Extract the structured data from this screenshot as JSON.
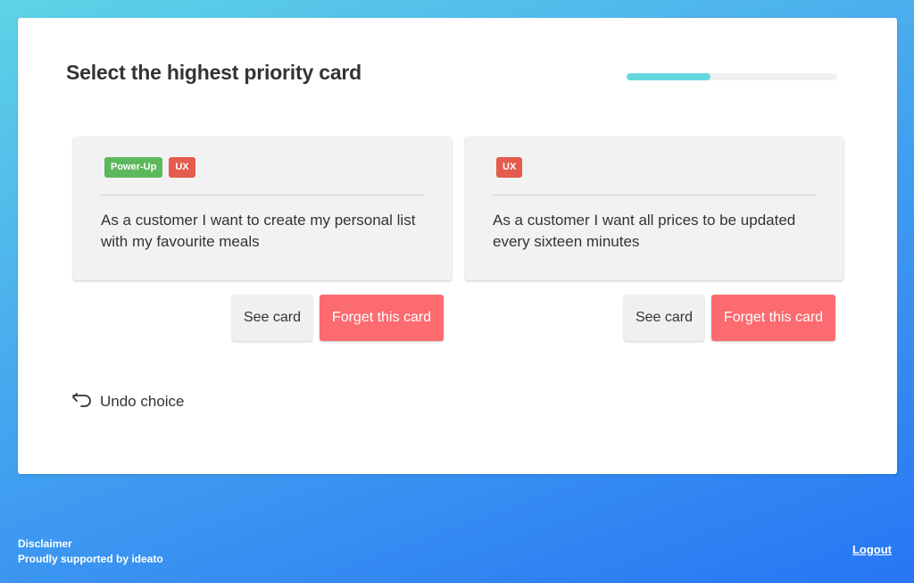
{
  "header": {
    "title": "Select the highest priority card",
    "progress_fraction": 0.4
  },
  "cards": [
    {
      "tags": [
        "Power-Up",
        "UX"
      ],
      "text": "As a customer I want to create my personal list with my favourite meals",
      "see_label": "See card",
      "forget_label": "Forget this card"
    },
    {
      "tags": [
        "UX"
      ],
      "text": "As a customer I want all prices to be updated every sixteen minutes",
      "see_label": "See card",
      "forget_label": "Forget this card"
    }
  ],
  "undo": {
    "label": "Undo choice",
    "icon": "undo-arrow-icon"
  },
  "footer": {
    "disclaimer": "Disclaimer",
    "supported": "Proudly supported by ideato",
    "logout": "Logout"
  },
  "colors": {
    "powerup_tag": "#5cb85c",
    "ux_tag": "#e35c4e",
    "forget_button": "#fc6b6f",
    "progress_fill": "#63d8df"
  }
}
